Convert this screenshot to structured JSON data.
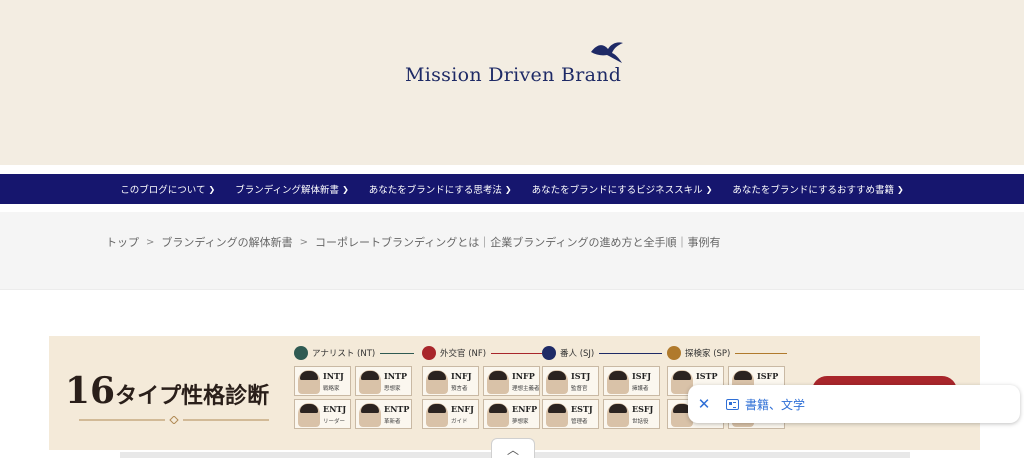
{
  "header": {
    "logo_text": "Mission Driven Brand",
    "logo_icon": "bird-icon",
    "brand_color": "#1e2a66",
    "background": "#f3ede2"
  },
  "nav": {
    "background": "#16166e",
    "items": [
      {
        "label": "このブログについて"
      },
      {
        "label": "ブランディング解体新書"
      },
      {
        "label": "あなたをブランドにする思考法"
      },
      {
        "label": "あなたをブランドにするビジネススキル"
      },
      {
        "label": "あなたをブランドにするおすすめ書籍"
      }
    ],
    "chevron": "❯"
  },
  "breadcrumb": {
    "separator": ">",
    "items": [
      {
        "label": "トップ"
      },
      {
        "label": "ブランディングの解体新書"
      },
      {
        "label": "コーポレートブランディングとは｜企業ブランディングの進め方と全手順｜事例有"
      }
    ]
  },
  "banner": {
    "title_number": "16",
    "title_rest": "タイプ性格診断",
    "groups": [
      {
        "label": "アナリスト (NT)",
        "color": "#2f5a52",
        "icon": "brain-icon",
        "cards": [
          {
            "code": "INTJ",
            "role": "戦略家"
          },
          {
            "code": "INTP",
            "role": "思想家"
          },
          {
            "code": "ENTJ",
            "role": "リーダー"
          },
          {
            "code": "ENTP",
            "role": "革新者"
          }
        ]
      },
      {
        "label": "外交官 (NF)",
        "color": "#a8262b",
        "icon": "heart-icon",
        "cards": [
          {
            "code": "INFJ",
            "role": "預言者"
          },
          {
            "code": "INFP",
            "role": "理想主義者"
          },
          {
            "code": "ENFJ",
            "role": "ガイド"
          },
          {
            "code": "ENFP",
            "role": "夢想家"
          }
        ]
      },
      {
        "label": "番人 (SJ)",
        "color": "#1e2a66",
        "icon": "shield-icon",
        "cards": [
          {
            "code": "ISTJ",
            "role": "監督官"
          },
          {
            "code": "ISFJ",
            "role": "擁護者"
          },
          {
            "code": "ESTJ",
            "role": "管理者"
          },
          {
            "code": "ESFJ",
            "role": "世話役"
          }
        ]
      },
      {
        "label": "探検家 (SP)",
        "color": "#b07a2c",
        "icon": "compass-icon",
        "cards": [
          {
            "code": "ISTP",
            "role": ""
          },
          {
            "code": "ISFP",
            "role": ""
          },
          {
            "code": "",
            "role": ""
          },
          {
            "code": "",
            "role": ""
          }
        ]
      }
    ]
  },
  "chip": {
    "close": "✕",
    "label": "書籍、文学",
    "color": "#2f6fd6"
  },
  "scroll_handle": "︿"
}
